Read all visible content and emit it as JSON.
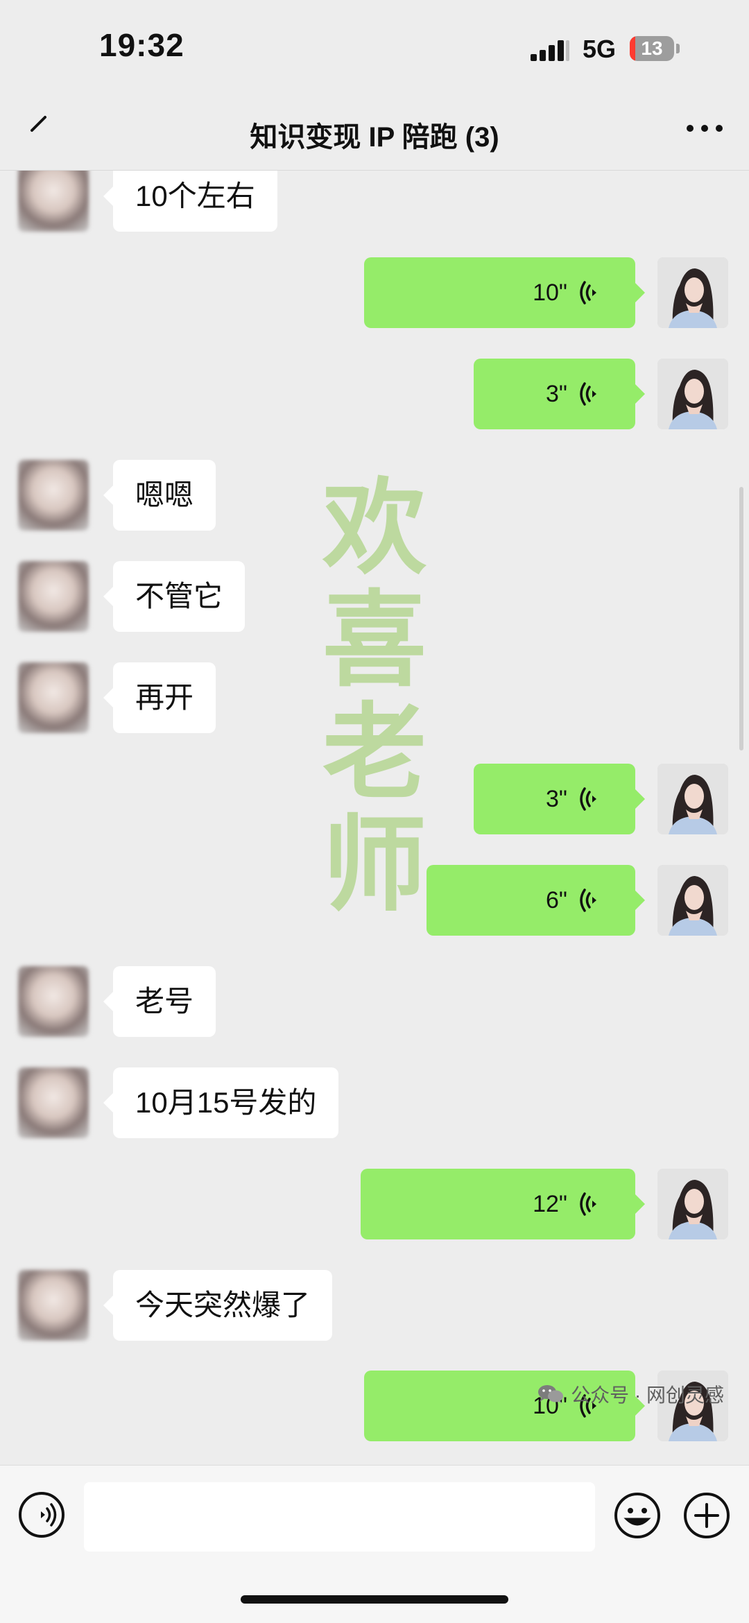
{
  "status_bar": {
    "time": "19:32",
    "network": "5G",
    "battery": "13",
    "battery_level_percent": 13,
    "signal_icon": "signal-bars-icon"
  },
  "nav_bar": {
    "title": "知识变现 IP 陪跑 (3)",
    "back_icon": "back-arrow-icon",
    "more_icon": "more-dots-icon"
  },
  "messages": [
    {
      "sender": "other",
      "type": "text",
      "text": "10个左右"
    },
    {
      "sender": "me",
      "type": "voice",
      "duration": "10\""
    },
    {
      "sender": "me",
      "type": "voice",
      "duration": "3\""
    },
    {
      "sender": "other",
      "type": "text",
      "text": "嗯嗯"
    },
    {
      "sender": "other",
      "type": "text",
      "text": "不管它"
    },
    {
      "sender": "other",
      "type": "text",
      "text": "再开"
    },
    {
      "sender": "me",
      "type": "voice",
      "duration": "3\""
    },
    {
      "sender": "me",
      "type": "voice",
      "duration": "6\""
    },
    {
      "sender": "other",
      "type": "text",
      "text": "老号"
    },
    {
      "sender": "other",
      "type": "text",
      "text": "10月15号发的"
    },
    {
      "sender": "me",
      "type": "voice",
      "duration": "12\""
    },
    {
      "sender": "other",
      "type": "text",
      "text": "今天突然爆了"
    },
    {
      "sender": "me",
      "type": "voice",
      "duration": "10\""
    }
  ],
  "watermark": {
    "chars": [
      "欢",
      "喜",
      "老",
      "师"
    ],
    "color": "#96c85f"
  },
  "input_bar": {
    "voice_icon": "voice-toggle-icon",
    "message_value": "",
    "emoji_icon": "emoji-icon",
    "plus_icon": "plus-icon"
  },
  "footer": {
    "text": "公众号 · 网创灵感",
    "icon": "wechat-icon"
  },
  "colors": {
    "background": "#ededed",
    "my_bubble": "#95ec69",
    "other_bubble": "#ffffff",
    "battery_low": "#ff3b30"
  }
}
